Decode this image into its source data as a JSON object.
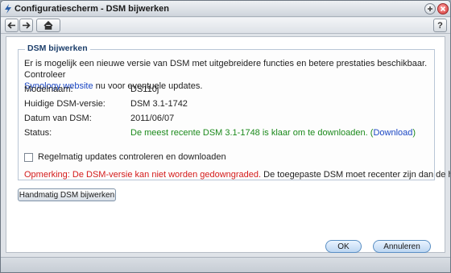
{
  "window": {
    "title": "Configuratiescherm - DSM bijwerken"
  },
  "toolbar": {
    "help_label": "?"
  },
  "section": {
    "legend": "DSM bijwerken",
    "intro_text": "Er is mogelijk een nieuwe versie van DSM met uitgebreidere functies en betere prestaties beschikbaar. Controleer",
    "intro_link": "Synology website",
    "intro_tail": "nu voor eventuele updates."
  },
  "info": {
    "rows": [
      {
        "label": "Modelnaam:",
        "value": "DS110j"
      },
      {
        "label": "Huidige DSM-versie:",
        "value": "DSM 3.1-1742"
      },
      {
        "label": "Datum van DSM:",
        "value": "2011/06/07"
      }
    ],
    "status_label": "Status:",
    "status_text": "De meest recente DSM 3.1-1748 is klaar om te downloaden.",
    "status_link_open": "(",
    "status_link": "Download",
    "status_link_close": ")"
  },
  "auto_update": {
    "label": "Regelmatig updates controleren en downloaden",
    "checked": false
  },
  "note": {
    "warning": "Opmerking: De DSM-versie kan niet worden gedowngraded.",
    "text": "De toegepaste DSM moet recenter zijn dan de huidige versie."
  },
  "buttons": {
    "manual": "Handmatig DSM bijwerken",
    "ok": "OK",
    "cancel": "Annuleren"
  },
  "colors": {
    "link": "#1b47c4",
    "status_ok": "#1c8a1c",
    "warning": "#d41b1b",
    "legend": "#1d3f6b"
  }
}
